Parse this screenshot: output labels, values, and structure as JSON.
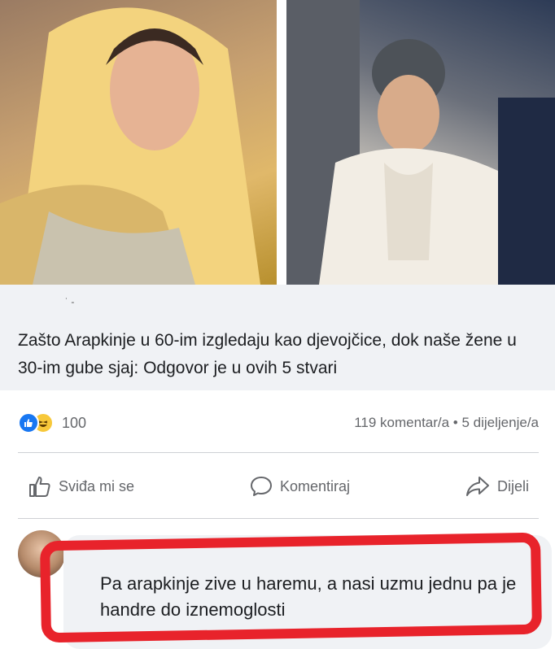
{
  "post": {
    "info_icon": "info-icon",
    "source": "˙ -",
    "headline": "Zašto Arapkinje u 60-im izgledaju kao djevojčice, dok naše žene u 30-im gube sjaj: Odgovor je u ovih 5 stvari"
  },
  "reactions": {
    "icons": [
      "like-reaction-icon",
      "haha-reaction-icon"
    ],
    "count": "100",
    "stats": "119 komentar/a • 5 dijeljenje/a"
  },
  "actions": {
    "like_label": "Sviđa mi se",
    "comment_label": "Komentiraj",
    "share_label": "Dijeli"
  },
  "comment": {
    "text": "Pa arapkinje zive u haremu, a nasi uzmu jednu pa je handre do iznemoglosti"
  },
  "colors": {
    "highlight": "#e8232b",
    "facebook_blue": "#1877f2",
    "meta_bg": "#f0f2f5",
    "secondary_text": "#65676b"
  }
}
